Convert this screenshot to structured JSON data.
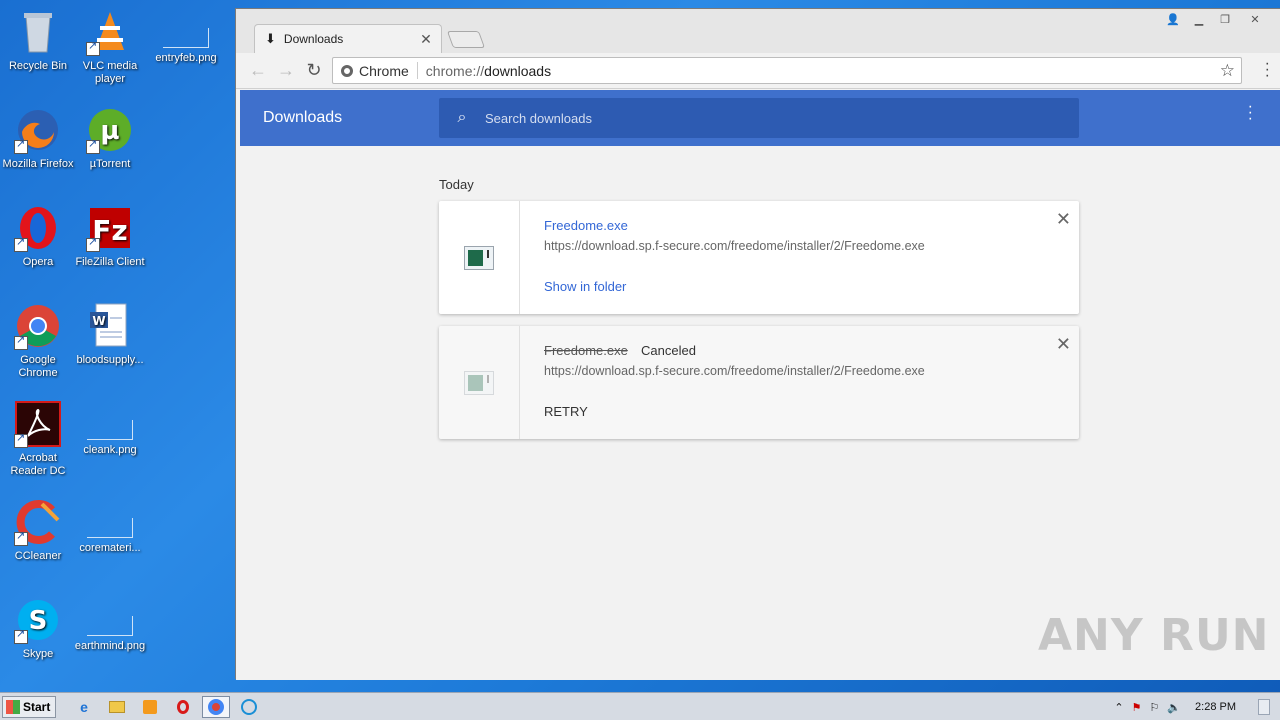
{
  "desktop": {
    "icons": [
      {
        "label": "Recycle Bin"
      },
      {
        "label": "VLC media player"
      },
      {
        "label": "entryfeb.png"
      },
      {
        "label": "Mozilla Firefox"
      },
      {
        "label": "µTorrent"
      },
      {
        "label": "Opera"
      },
      {
        "label": "FileZilla Client"
      },
      {
        "label": "Google Chrome"
      },
      {
        "label": "bloodsupply..."
      },
      {
        "label": "Acrobat Reader DC"
      },
      {
        "label": "cleank.png"
      },
      {
        "label": "CCleaner"
      },
      {
        "label": "coremateri..."
      },
      {
        "label": "Skype"
      },
      {
        "label": "earthmind.png"
      }
    ]
  },
  "browser": {
    "tab_title": "Downloads",
    "site_label": "Chrome",
    "url_scheme": "chrome://",
    "url_host": "downloads"
  },
  "downloads": {
    "header_title": "Downloads",
    "search_placeholder": "Search downloads",
    "section_label": "Today",
    "items": [
      {
        "name": "Freedome.exe",
        "state": "",
        "url": "https://download.sp.f-secure.com/freedome/installer/2/Freedome.exe",
        "action": "Show in folder"
      },
      {
        "name": "Freedome.exe",
        "state": "Canceled",
        "url": "https://download.sp.f-secure.com/freedome/installer/2/Freedome.exe",
        "action": "RETRY"
      }
    ]
  },
  "watermark": "ANY RUN",
  "taskbar": {
    "start_label": "Start",
    "clock": "2:28 PM"
  }
}
